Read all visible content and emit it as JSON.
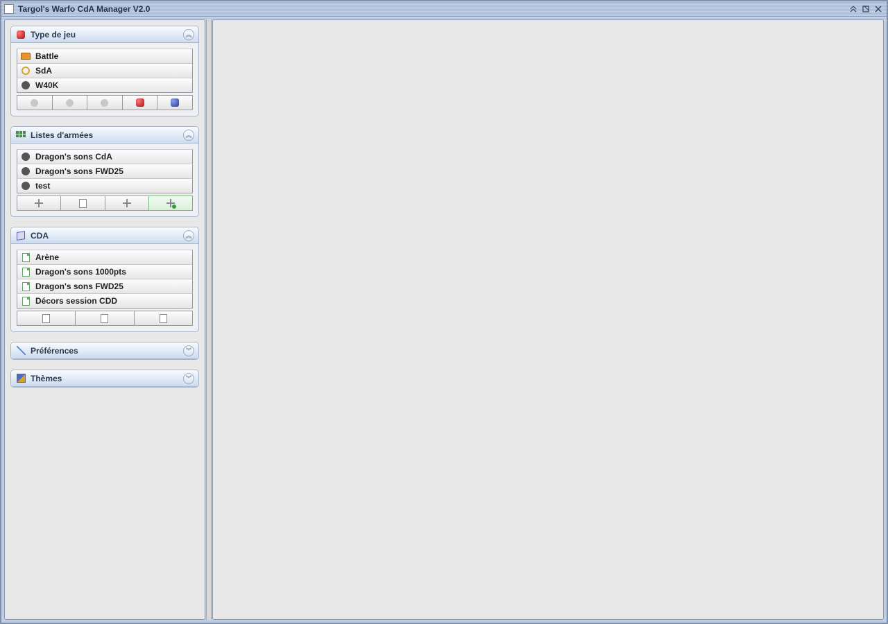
{
  "window": {
    "title": "Targol's Warfo CdA Manager V2.0"
  },
  "panels": {
    "gametype": {
      "title": "Type de jeu",
      "items": [
        {
          "label": "Battle"
        },
        {
          "label": "SdA"
        },
        {
          "label": "W40K"
        }
      ]
    },
    "armylists": {
      "title": "Listes d'armées",
      "items": [
        {
          "label": "Dragon's sons CdA"
        },
        {
          "label": "Dragon's sons FWD25"
        },
        {
          "label": "test"
        }
      ]
    },
    "cda": {
      "title": "CDA",
      "items": [
        {
          "label": "Arène"
        },
        {
          "label": "Dragon's sons 1000pts"
        },
        {
          "label": "Dragon's sons FWD25"
        },
        {
          "label": "Décors session CDD"
        }
      ]
    },
    "prefs": {
      "title": "Préférences"
    },
    "themes": {
      "title": "Thèmes"
    }
  }
}
